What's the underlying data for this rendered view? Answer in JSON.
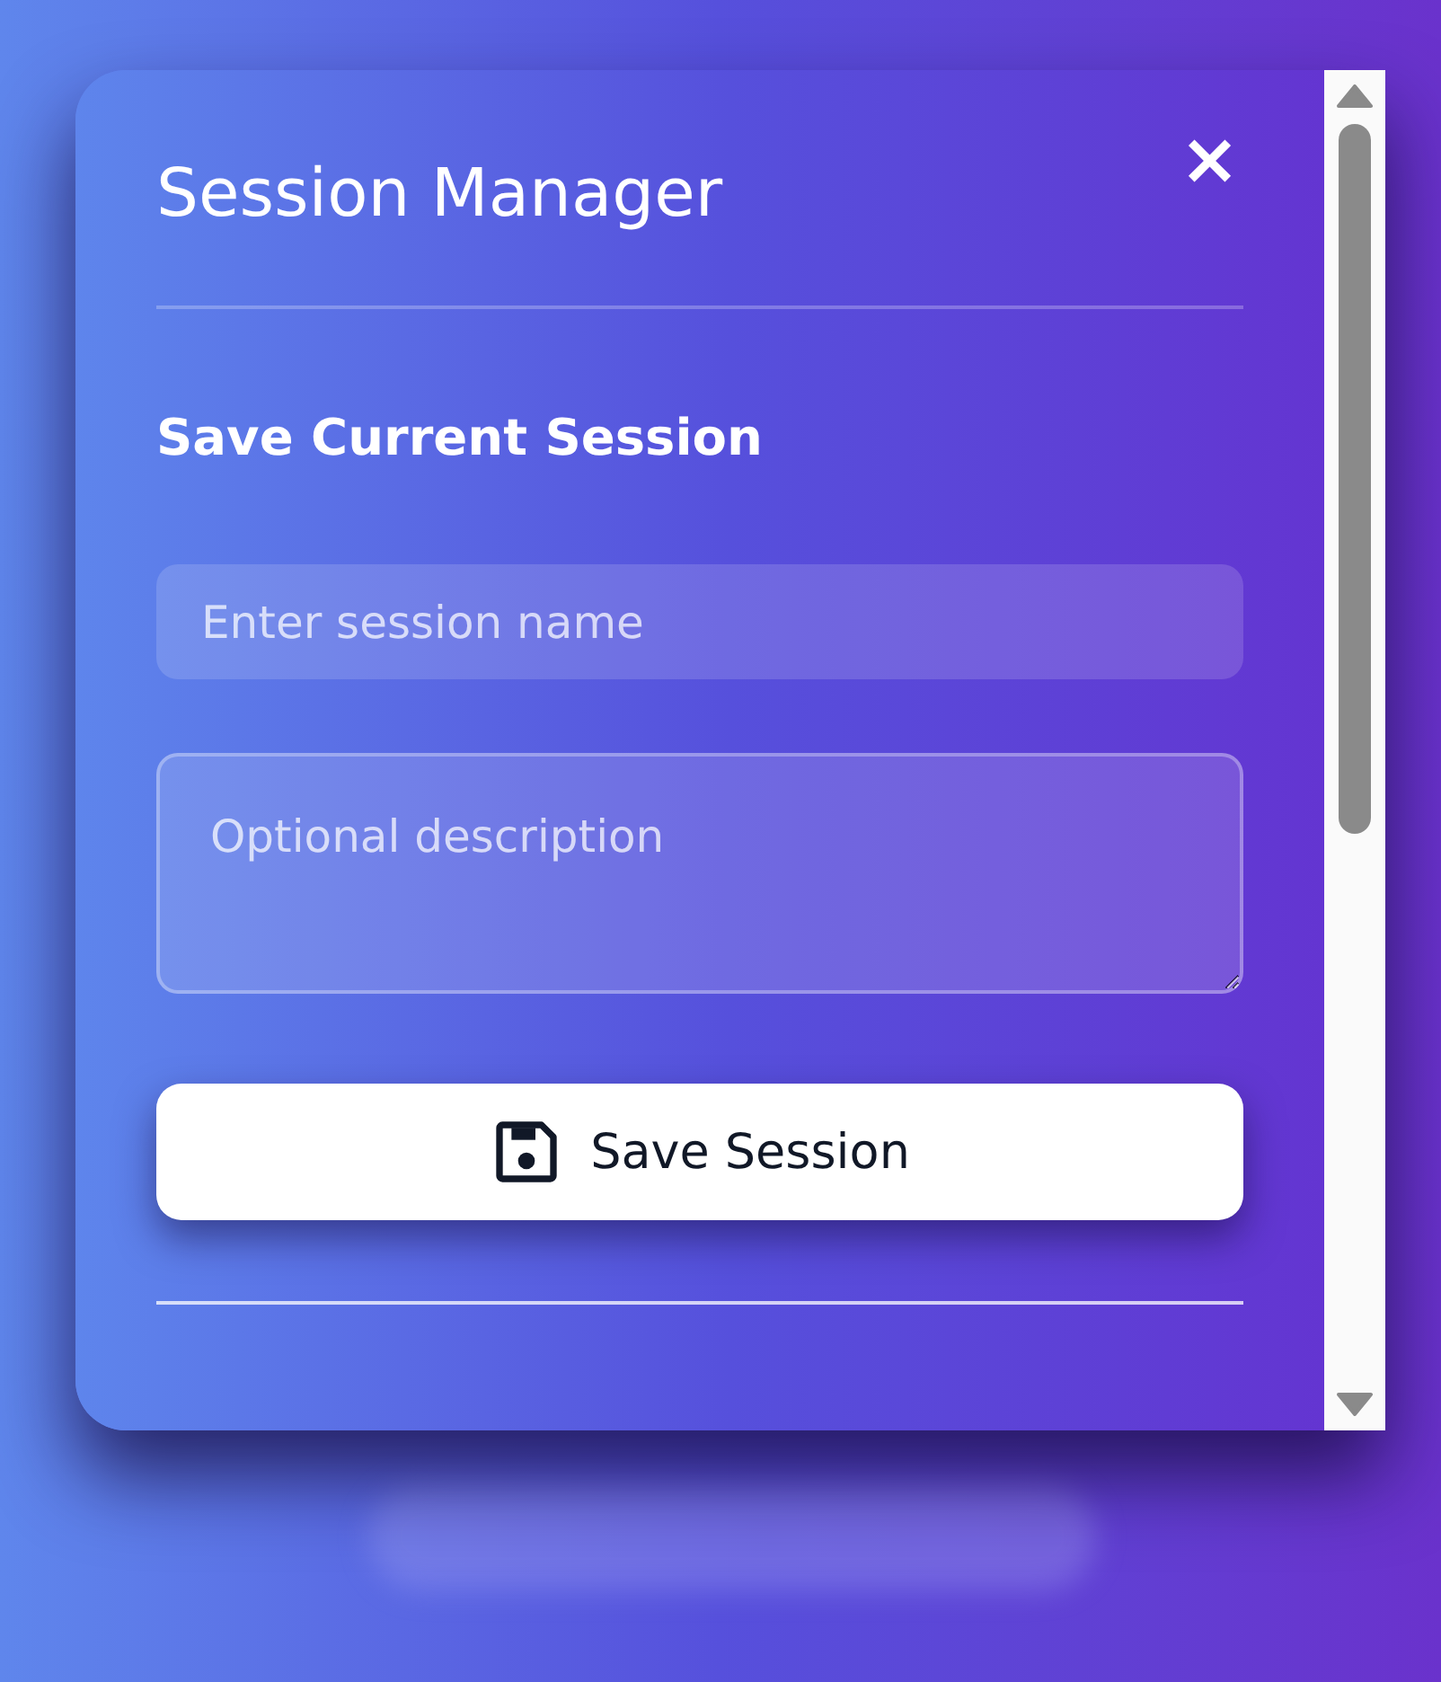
{
  "dialog": {
    "title": "Session Manager",
    "close": "×"
  },
  "save_section": {
    "heading": "Save Current Session",
    "name_field": {
      "placeholder": "Enter session name"
    },
    "description_field": {
      "placeholder": "Optional description"
    },
    "button": "Save Session"
  }
}
